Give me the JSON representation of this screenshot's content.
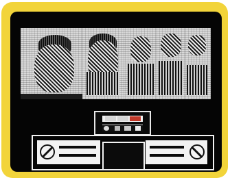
{
  "scene": {
    "frame_color": "#f2d43a",
    "screen_color": "#050505",
    "portraits": [
      "portrait-1",
      "portrait-2",
      "portrait-3",
      "portrait-4",
      "portrait-5"
    ],
    "console_indicators": [
      "white",
      "white",
      "red"
    ],
    "deck_panels": [
      "left-panel",
      "center-monitor",
      "right-panel"
    ]
  }
}
